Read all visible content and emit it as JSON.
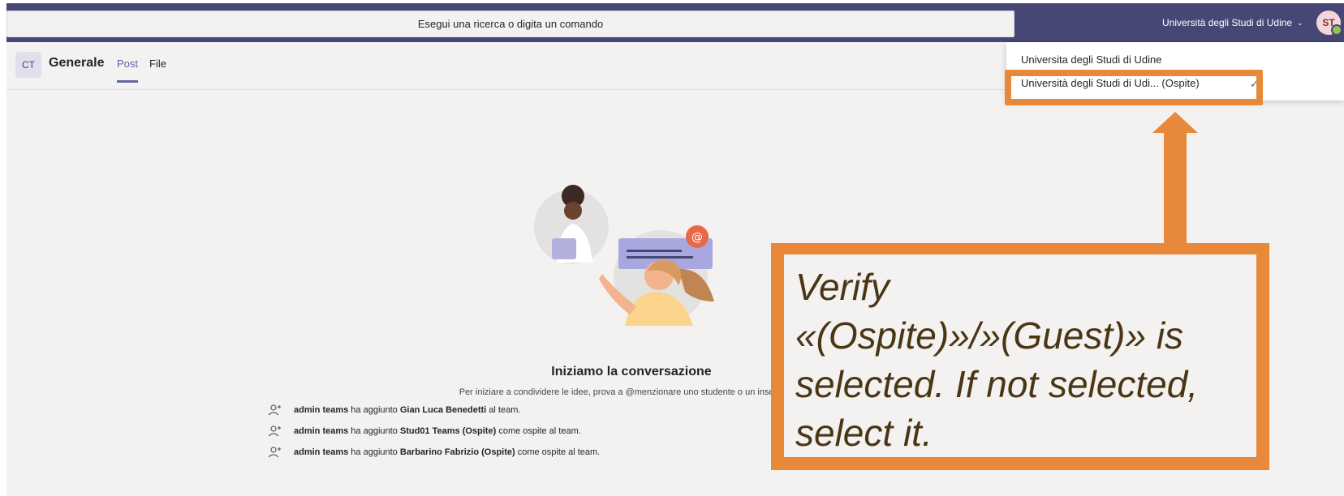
{
  "search": {
    "placeholder": "Esegui una ricerca o digita un comando"
  },
  "org_switcher": {
    "label": "Università degli Studi di Udine",
    "chevron": "⌄"
  },
  "user": {
    "initials": "ST",
    "presence_color": "#92c353"
  },
  "channel": {
    "team_initials": "CT",
    "name": "Generale",
    "tabs": [
      {
        "label": "Post"
      },
      {
        "label": "File"
      }
    ]
  },
  "dropdown": {
    "items": [
      {
        "label": "Universita degli Studi di Udine",
        "selected": false
      },
      {
        "label": "Università degli Studi di Udi... (Ospite)",
        "selected": true
      }
    ],
    "check": "✓"
  },
  "conversation": {
    "title": "Iniziamo la conversazione",
    "subtitle": "Per iniziare a condividere le idee, prova a @menzionare uno studente o un insegnante.",
    "activity": [
      {
        "actor": "admin teams",
        "mid": " ha aggiunto ",
        "target": "Gian Luca Benedetti",
        "tail": " al team."
      },
      {
        "actor": "admin teams",
        "mid": " ha aggiunto ",
        "target": "Stud01 Teams (Ospite)",
        "tail": " come ospite al team."
      },
      {
        "actor": "admin teams",
        "mid": " ha aggiunto ",
        "target": "Barbarino Fabrizio (Ospite)",
        "tail": " come ospite al team."
      }
    ]
  },
  "callout": {
    "text_lines": [
      "Verify",
      "«(Ospite)»/»(Guest)» is",
      "selected. If not selected,",
      "select it."
    ]
  },
  "colors": {
    "topbar": "#464775",
    "accent": "#6264a7",
    "annotation": "#e8883a"
  }
}
